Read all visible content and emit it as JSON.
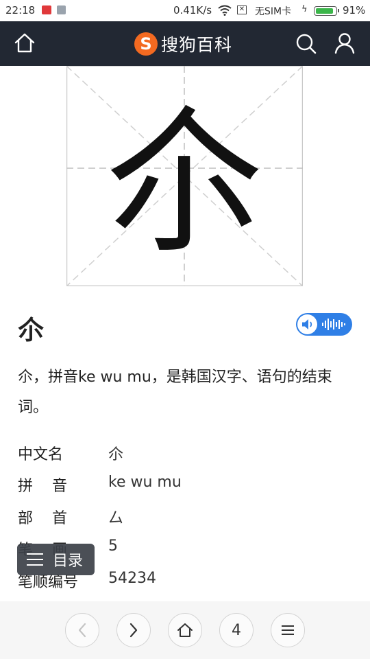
{
  "status_bar": {
    "time": "22:18",
    "speed": "0.41K/s",
    "sim": "无SIM卡",
    "battery_level": "91%",
    "battery_fraction": 0.91,
    "accent_green": "#3bb54a"
  },
  "app_bar": {
    "brand_logo": "S",
    "brand_name": "搜狗百科",
    "background": "#222833",
    "logo_color": "#f36a21",
    "icons": [
      "home-icon",
      "search-icon",
      "user-icon"
    ]
  },
  "entry": {
    "character": "尒",
    "title": "尒",
    "summary": "尒，拼音ke wu mu，是韩国汉字、语句的结束词。",
    "audio_accent": "#2f7fe6"
  },
  "info": [
    {
      "label": "中文名",
      "value": "尒"
    },
    {
      "label": "拼音",
      "value": "ke wu mu"
    },
    {
      "label": "部首",
      "value": "厶"
    },
    {
      "label": "笔画",
      "value": "5"
    },
    {
      "label": "笔顺编号",
      "value": "54234"
    }
  ],
  "catalog": {
    "label": "目录"
  },
  "bottom_nav": {
    "tab_count": "4",
    "icons": [
      "back-icon",
      "forward-icon",
      "home-icon",
      "tabs",
      "menu-icon"
    ]
  }
}
